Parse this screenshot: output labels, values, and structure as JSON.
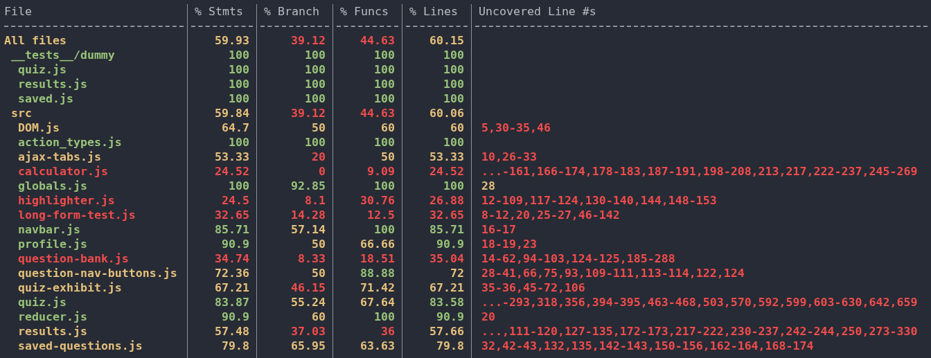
{
  "columns": [
    "File",
    "% Stmts",
    "% Branch",
    "% Funcs",
    "% Lines",
    "Uncovered Line #s"
  ],
  "rows": [
    {
      "file": "All files",
      "color": "#e5c07b",
      "cells": [
        {
          "text": "59.93",
          "color": "#e5c07b"
        },
        {
          "text": "39.12",
          "color": "#f14c4c"
        },
        {
          "text": "44.63",
          "color": "#f14c4c"
        },
        {
          "text": "60.15",
          "color": "#e5c07b"
        }
      ],
      "children": [
        {
          "file": "__tests__/dummy",
          "color": "#98c379",
          "cells": [
            {
              "text": "100",
              "color": "#98c379"
            },
            {
              "text": "100",
              "color": "#98c379"
            },
            {
              "text": "100",
              "color": "#98c379"
            },
            {
              "text": "100",
              "color": "#98c379"
            }
          ],
          "children": [
            {
              "file": "quiz.js",
              "color": "#98c379",
              "cells": [
                {
                  "text": "100",
                  "color": "#98c379"
                },
                {
                  "text": "100",
                  "color": "#98c379"
                },
                {
                  "text": "100",
                  "color": "#98c379"
                },
                {
                  "text": "100",
                  "color": "#98c379"
                }
              ]
            },
            {
              "file": "results.js",
              "color": "#98c379",
              "cells": [
                {
                  "text": "100",
                  "color": "#98c379"
                },
                {
                  "text": "100",
                  "color": "#98c379"
                },
                {
                  "text": "100",
                  "color": "#98c379"
                },
                {
                  "text": "100",
                  "color": "#98c379"
                }
              ]
            },
            {
              "file": "saved.js",
              "color": "#98c379",
              "cells": [
                {
                  "text": "100",
                  "color": "#98c379"
                },
                {
                  "text": "100",
                  "color": "#98c379"
                },
                {
                  "text": "100",
                  "color": "#98c379"
                },
                {
                  "text": "100",
                  "color": "#98c379"
                }
              ]
            }
          ]
        },
        {
          "file": "src",
          "color": "#e5c07b",
          "cells": [
            {
              "text": "59.84",
              "color": "#e5c07b"
            },
            {
              "text": "39.12",
              "color": "#f14c4c"
            },
            {
              "text": "44.63",
              "color": "#f14c4c"
            },
            {
              "text": "60.06",
              "color": "#e5c07b"
            }
          ],
          "children": [
            {
              "file": "DOM.js",
              "color": "#e5c07b",
              "cells": [
                {
                  "text": "64.7",
                  "color": "#e5c07b"
                },
                {
                  "text": "50",
                  "color": "#e5c07b"
                },
                {
                  "text": "60",
                  "color": "#e5c07b"
                },
                {
                  "text": "60",
                  "color": "#e5c07b"
                }
              ],
              "uncovered": {
                "text": "5,30-35,46",
                "color": "#f14c4c"
              }
            },
            {
              "file": "action_types.js",
              "color": "#98c379",
              "cells": [
                {
                  "text": "100",
                  "color": "#98c379"
                },
                {
                  "text": "100",
                  "color": "#98c379"
                },
                {
                  "text": "100",
                  "color": "#98c379"
                },
                {
                  "text": "100",
                  "color": "#98c379"
                }
              ]
            },
            {
              "file": "ajax-tabs.js",
              "color": "#e5c07b",
              "cells": [
                {
                  "text": "53.33",
                  "color": "#e5c07b"
                },
                {
                  "text": "20",
                  "color": "#f14c4c"
                },
                {
                  "text": "50",
                  "color": "#e5c07b"
                },
                {
                  "text": "53.33",
                  "color": "#e5c07b"
                }
              ],
              "uncovered": {
                "text": "10,26-33",
                "color": "#f14c4c"
              }
            },
            {
              "file": "calculator.js",
              "color": "#f14c4c",
              "cells": [
                {
                  "text": "24.52",
                  "color": "#f14c4c"
                },
                {
                  "text": "0",
                  "color": "#f14c4c"
                },
                {
                  "text": "9.09",
                  "color": "#f14c4c"
                },
                {
                  "text": "24.52",
                  "color": "#f14c4c"
                }
              ],
              "uncovered": {
                "text": "...-161,166-174,178-183,187-191,198-208,213,217,222-237,245-269",
                "color": "#f14c4c"
              }
            },
            {
              "file": "globals.js",
              "color": "#98c379",
              "cells": [
                {
                  "text": "100",
                  "color": "#98c379"
                },
                {
                  "text": "92.85",
                  "color": "#98c379"
                },
                {
                  "text": "100",
                  "color": "#98c379"
                },
                {
                  "text": "100",
                  "color": "#98c379"
                }
              ],
              "uncovered": {
                "text": "28",
                "color": "#e5c07b"
              }
            },
            {
              "file": "highlighter.js",
              "color": "#f14c4c",
              "cells": [
                {
                  "text": "24.5",
                  "color": "#f14c4c"
                },
                {
                  "text": "8.1",
                  "color": "#f14c4c"
                },
                {
                  "text": "30.76",
                  "color": "#f14c4c"
                },
                {
                  "text": "26.88",
                  "color": "#f14c4c"
                }
              ],
              "uncovered": {
                "text": "12-109,117-124,130-140,144,148-153",
                "color": "#f14c4c"
              }
            },
            {
              "file": "long-form-test.js",
              "color": "#f14c4c",
              "cells": [
                {
                  "text": "32.65",
                  "color": "#f14c4c"
                },
                {
                  "text": "14.28",
                  "color": "#f14c4c"
                },
                {
                  "text": "12.5",
                  "color": "#f14c4c"
                },
                {
                  "text": "32.65",
                  "color": "#f14c4c"
                }
              ],
              "uncovered": {
                "text": "8-12,20,25-27,46-142",
                "color": "#f14c4c"
              }
            },
            {
              "file": "navbar.js",
              "color": "#98c379",
              "cells": [
                {
                  "text": "85.71",
                  "color": "#98c379"
                },
                {
                  "text": "57.14",
                  "color": "#e5c07b"
                },
                {
                  "text": "100",
                  "color": "#98c379"
                },
                {
                  "text": "85.71",
                  "color": "#98c379"
                }
              ],
              "uncovered": {
                "text": "16-17",
                "color": "#f14c4c"
              }
            },
            {
              "file": "profile.js",
              "color": "#98c379",
              "cells": [
                {
                  "text": "90.9",
                  "color": "#98c379"
                },
                {
                  "text": "50",
                  "color": "#e5c07b"
                },
                {
                  "text": "66.66",
                  "color": "#e5c07b"
                },
                {
                  "text": "90.9",
                  "color": "#98c379"
                }
              ],
              "uncovered": {
                "text": "18-19,23",
                "color": "#f14c4c"
              }
            },
            {
              "file": "question-bank.js",
              "color": "#f14c4c",
              "cells": [
                {
                  "text": "34.74",
                  "color": "#f14c4c"
                },
                {
                  "text": "8.33",
                  "color": "#f14c4c"
                },
                {
                  "text": "18.51",
                  "color": "#f14c4c"
                },
                {
                  "text": "35.04",
                  "color": "#f14c4c"
                }
              ],
              "uncovered": {
                "text": "14-62,94-103,124-125,185-288",
                "color": "#f14c4c"
              }
            },
            {
              "file": "question-nav-buttons.js",
              "color": "#e5c07b",
              "cells": [
                {
                  "text": "72.36",
                  "color": "#e5c07b"
                },
                {
                  "text": "50",
                  "color": "#e5c07b"
                },
                {
                  "text": "88.88",
                  "color": "#98c379"
                },
                {
                  "text": "72",
                  "color": "#e5c07b"
                }
              ],
              "uncovered": {
                "text": "28-41,66,75,93,109-111,113-114,122,124",
                "color": "#f14c4c"
              }
            },
            {
              "file": "quiz-exhibit.js",
              "color": "#e5c07b",
              "cells": [
                {
                  "text": "67.21",
                  "color": "#e5c07b"
                },
                {
                  "text": "46.15",
                  "color": "#f14c4c"
                },
                {
                  "text": "71.42",
                  "color": "#e5c07b"
                },
                {
                  "text": "67.21",
                  "color": "#e5c07b"
                }
              ],
              "uncovered": {
                "text": "35-36,45-72,106",
                "color": "#f14c4c"
              }
            },
            {
              "file": "quiz.js",
              "color": "#98c379",
              "cells": [
                {
                  "text": "83.87",
                  "color": "#98c379"
                },
                {
                  "text": "55.24",
                  "color": "#e5c07b"
                },
                {
                  "text": "67.64",
                  "color": "#e5c07b"
                },
                {
                  "text": "83.58",
                  "color": "#98c379"
                }
              ],
              "uncovered": {
                "text": "...-293,318,356,394-395,463-468,503,570,592,599,603-630,642,659",
                "color": "#f14c4c"
              }
            },
            {
              "file": "reducer.js",
              "color": "#98c379",
              "cells": [
                {
                  "text": "90.9",
                  "color": "#98c379"
                },
                {
                  "text": "60",
                  "color": "#e5c07b"
                },
                {
                  "text": "100",
                  "color": "#98c379"
                },
                {
                  "text": "90.9",
                  "color": "#98c379"
                }
              ],
              "uncovered": {
                "text": "20",
                "color": "#f14c4c"
              }
            },
            {
              "file": "results.js",
              "color": "#e5c07b",
              "cells": [
                {
                  "text": "57.48",
                  "color": "#e5c07b"
                },
                {
                  "text": "37.03",
                  "color": "#f14c4c"
                },
                {
                  "text": "36",
                  "color": "#f14c4c"
                },
                {
                  "text": "57.66",
                  "color": "#e5c07b"
                }
              ],
              "uncovered": {
                "text": "...,111-120,127-135,172-173,217-222,230-237,242-244,250,273-330",
                "color": "#f14c4c"
              }
            },
            {
              "file": "saved-questions.js",
              "color": "#e5c07b",
              "cells": [
                {
                  "text": "79.8",
                  "color": "#e5c07b"
                },
                {
                  "text": "65.95",
                  "color": "#e5c07b"
                },
                {
                  "text": "63.63",
                  "color": "#e5c07b"
                },
                {
                  "text": "79.8",
                  "color": "#e5c07b"
                }
              ],
              "uncovered": {
                "text": "32,42-43,132,135,142-143,150-156,162-164,168-174",
                "color": "#f14c4c"
              }
            }
          ]
        }
      ]
    }
  ]
}
